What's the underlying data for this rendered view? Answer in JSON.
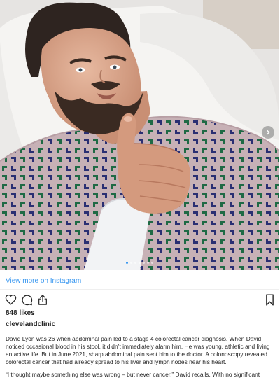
{
  "post": {
    "photo_alt": "Man in hospital gown giving thumbs up",
    "carousel": {
      "total": 7,
      "active_index": 0
    },
    "view_more_label": "View more on Instagram",
    "icons": [
      "heart-icon",
      "comment-icon",
      "share-icon",
      "bookmark-icon",
      "chevron-right-icon"
    ],
    "likes": "848 likes",
    "username": "clevelandclinic",
    "caption": "David Lyon was 26 when abdominal pain led to a stage 4 colorectal cancer diagnosis. When David noticed occasional blood in his stool, it didn’t immediately alarm him. He was young, athletic and living an active life. But in June 2021, sharp abdominal pain sent him to the doctor. A colonoscopy revealed colorectal cancer that had already spread to his liver and lymph nodes near his heart.",
    "caption_next": "“I thought maybe something else was wrong – but never cancer,” David recalls. With no significant",
    "colors": {
      "link": "#3897f0",
      "text": "#262626",
      "divider": "#efefef"
    }
  }
}
